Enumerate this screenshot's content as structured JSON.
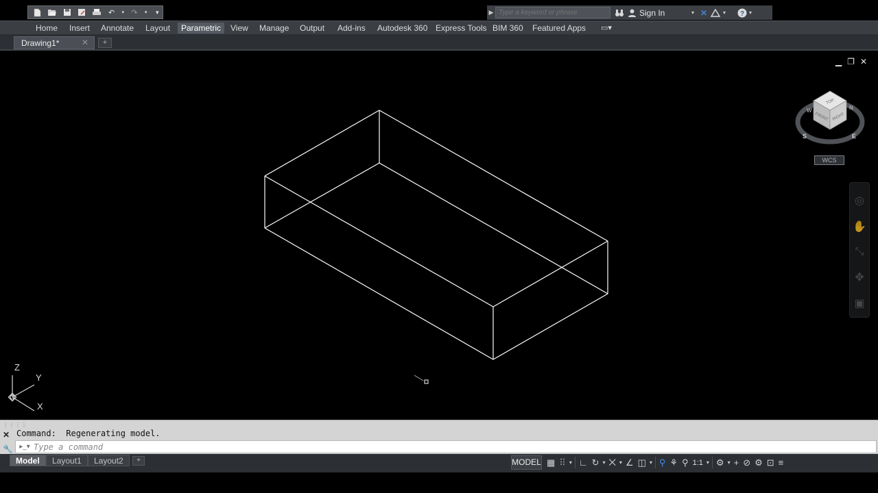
{
  "qat": {
    "icons": [
      "new-icon",
      "open-icon",
      "save-icon",
      "save-as-icon",
      "plot-icon",
      "undo-icon",
      "redo-icon",
      "customize-icon"
    ]
  },
  "search": {
    "placeholder": "Type a keyword or phrase",
    "sign_in": "Sign In"
  },
  "ribbon": {
    "tabs": [
      {
        "label": "Home"
      },
      {
        "label": "Insert"
      },
      {
        "label": "Annotate"
      },
      {
        "label": "Layout"
      },
      {
        "label": "Parametric",
        "active": true
      },
      {
        "label": "View"
      },
      {
        "label": "Manage"
      },
      {
        "label": "Output"
      },
      {
        "label": "Add-ins"
      },
      {
        "label": "Autodesk 360"
      },
      {
        "label": "Express Tools"
      },
      {
        "label": "BIM 360"
      },
      {
        "label": "Featured Apps"
      }
    ]
  },
  "file_tabs": {
    "current": "Drawing1*",
    "close": "✕",
    "add": "+"
  },
  "viewport": {
    "minimize": "▁",
    "restore": "❐",
    "close": "✕"
  },
  "navcube": {
    "faces": {
      "top": "TOP",
      "front": "FRONT",
      "right": "RIGHT"
    },
    "compass": {
      "n": "N",
      "s": "S",
      "e": "E",
      "w": "W"
    },
    "wcs": "WCS"
  },
  "ucs": {
    "x": "X",
    "y": "Y",
    "z": "Z"
  },
  "command": {
    "history": "Command:  Regenerating model.",
    "placeholder": "Type a command"
  },
  "layout_tabs": [
    {
      "label": "Model",
      "active": true
    },
    {
      "label": "Layout1"
    },
    {
      "label": "Layout2"
    }
  ],
  "status": {
    "model": "MODEL",
    "scale": "1:1",
    "accent": "#3f8ce8"
  }
}
